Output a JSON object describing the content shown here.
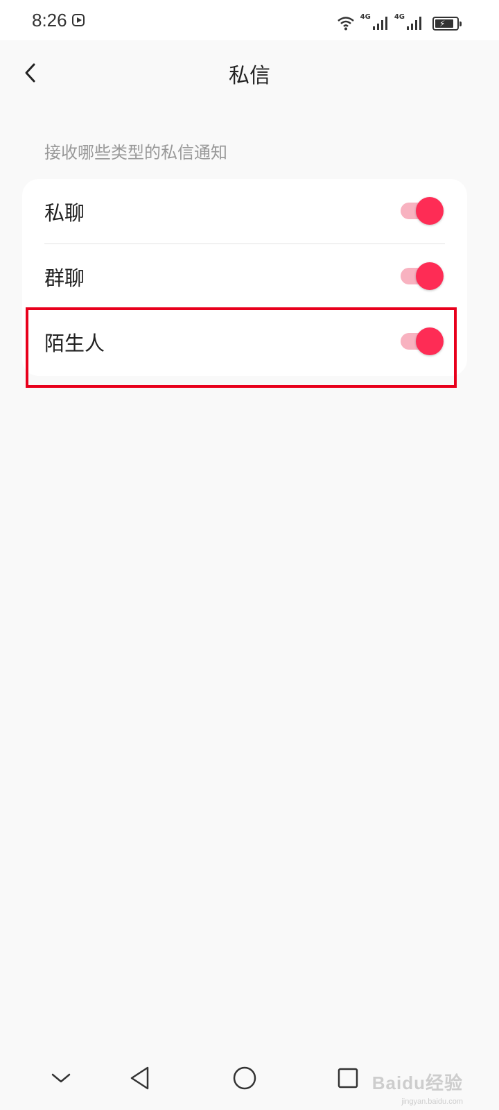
{
  "status_bar": {
    "time": "8:26",
    "network_1": "4G",
    "network_2": "4G",
    "icons": [
      "screen-record-icon",
      "wifi-icon",
      "signal-icon",
      "signal-icon",
      "battery-charging-icon"
    ]
  },
  "header": {
    "title": "私信",
    "back_icon": "chevron-left-icon"
  },
  "section": {
    "label": "接收哪些类型的私信通知"
  },
  "settings": {
    "items": [
      {
        "label": "私聊",
        "enabled": true
      },
      {
        "label": "群聊",
        "enabled": true
      },
      {
        "label": "陌生人",
        "enabled": true
      }
    ]
  },
  "highlight": {
    "target": "陌生人",
    "color": "#e8001c"
  },
  "colors": {
    "accent": "#fe2c55",
    "track": "#f8b2c0",
    "background": "#f9f9f9"
  },
  "bottom_nav": {
    "icons": [
      "chevron-down-icon",
      "back-triangle-icon",
      "home-circle-icon",
      "recents-square-icon"
    ]
  },
  "watermark": {
    "text": "Baidu经验",
    "sub": "jingyan.baidu.com"
  }
}
